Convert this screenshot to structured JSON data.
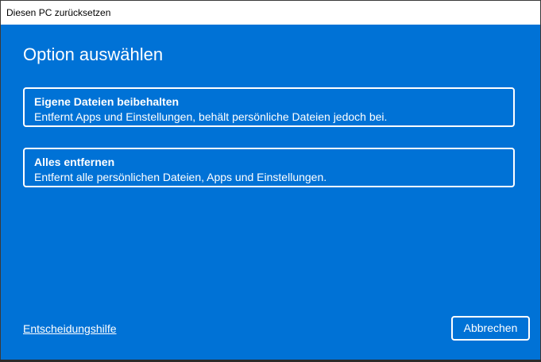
{
  "window": {
    "title": "Diesen PC zurücksetzen"
  },
  "main": {
    "heading": "Option auswählen",
    "options": [
      {
        "title": "Eigene Dateien beibehalten",
        "description": "Entfernt Apps und Einstellungen, behält persönliche Dateien jedoch bei."
      },
      {
        "title": "Alles entfernen",
        "description": "Entfernt alle persönlichen Dateien, Apps und Einstellungen."
      }
    ]
  },
  "footer": {
    "help_link": "Entscheidungshilfe",
    "cancel_label": "Abbrechen"
  },
  "colors": {
    "background": "#0072d6"
  }
}
